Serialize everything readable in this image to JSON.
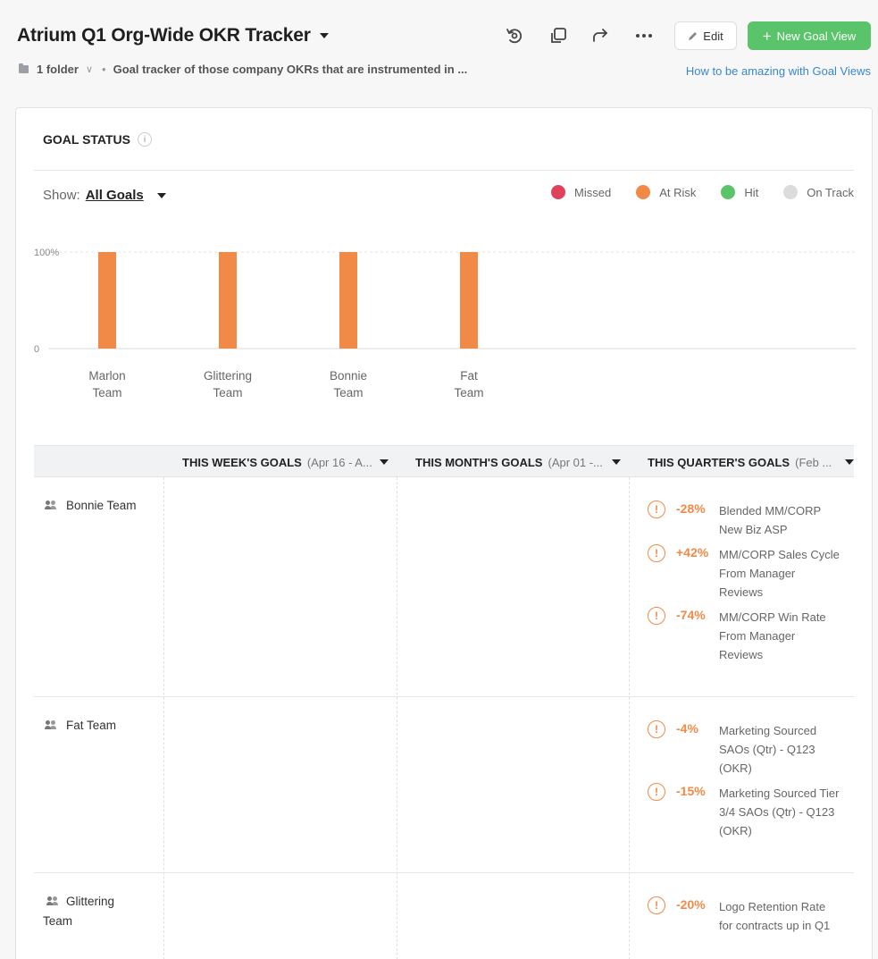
{
  "header": {
    "title": "Atrium Q1 Org-Wide OKR Tracker",
    "folder": "1 folder",
    "description": "Goal tracker of those company OKRs that are instrumented in ...",
    "edit_label": "Edit",
    "new_label": "New Goal View",
    "help_link": "How to be amazing with Goal Views",
    "icons": [
      "refresh-icon",
      "duplicate-icon",
      "share-icon",
      "more-icon"
    ]
  },
  "card": {
    "title": "GOAL STATUS",
    "show_label": "Show:",
    "show_value": "All Goals"
  },
  "legend": [
    {
      "label": "Missed",
      "color": "#e0415a"
    },
    {
      "label": "At Risk",
      "color": "#f08a46"
    },
    {
      "label": "Hit",
      "color": "#5ac46a"
    },
    {
      "label": "On Track",
      "color": "#dcdcdc"
    }
  ],
  "chart_data": {
    "type": "bar",
    "categories": [
      "Marlon Team",
      "Glittering Team",
      "Bonnie Team",
      "Fat Team"
    ],
    "series": [
      {
        "name": "At Risk",
        "values": [
          100,
          100,
          100,
          100
        ],
        "color": "#f08a46"
      }
    ],
    "yticks": [
      "100%",
      "0"
    ],
    "ylim": [
      0,
      100
    ]
  },
  "table": {
    "columns": [
      {
        "title": "THIS WEEK'S GOALS",
        "range": "(Apr 16 - A..."
      },
      {
        "title": "THIS MONTH'S GOALS",
        "range": "(Apr 01 -..."
      },
      {
        "title": "THIS QUARTER'S GOALS",
        "range": "(Feb ..."
      }
    ],
    "rows": [
      {
        "team": "Bonnie Team",
        "goals": [
          {
            "pct": "-28%",
            "label": "Blended MM/CORP New Biz ASP"
          },
          {
            "pct": "+42%",
            "label": "MM/CORP Sales Cycle From Manager Reviews"
          },
          {
            "pct": "-74%",
            "label": "MM/CORP Win Rate From Manager Reviews"
          }
        ]
      },
      {
        "team": "Fat Team",
        "goals": [
          {
            "pct": "-4%",
            "label": "Marketing Sourced SAOs (Qtr) - Q123 (OKR)"
          },
          {
            "pct": "-15%",
            "label": "Marketing Sourced Tier 3/4 SAOs (Qtr) - Q123 (OKR)"
          }
        ]
      },
      {
        "team": "Glittering Team",
        "goals": [
          {
            "pct": "-20%",
            "label": "Logo Retention Rate for contracts up in Q1"
          }
        ]
      }
    ]
  }
}
